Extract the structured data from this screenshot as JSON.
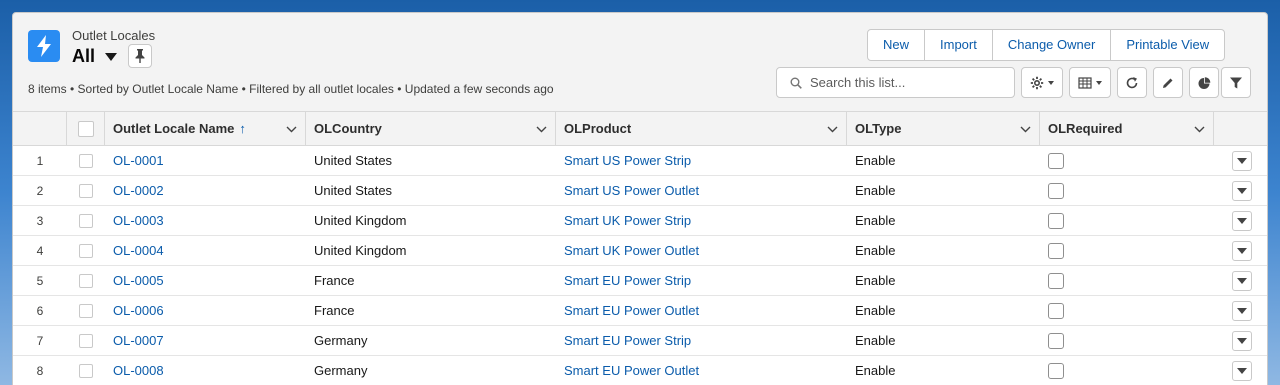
{
  "header": {
    "object_label": "Outlet Locales",
    "list_view_name": "All",
    "meta": "8 items • Sorted by Outlet Locale Name • Filtered by all outlet locales • Updated a few seconds ago",
    "icon": "lightning-bolt-icon",
    "icon_color": "#2a8cf2"
  },
  "actions": {
    "new": "New",
    "import": "Import",
    "change_owner": "Change Owner",
    "printable_view": "Printable View"
  },
  "search": {
    "placeholder": "Search this list..."
  },
  "table": {
    "columns": {
      "name": "Outlet Locale Name",
      "sort_indicator": "↑",
      "country": "OLCountry",
      "product": "OLProduct",
      "type": "OLType",
      "required": "OLRequired"
    },
    "rows": [
      {
        "num": "1",
        "name": "OL-0001",
        "country": "United States",
        "product": "Smart US Power Strip",
        "type": "Enable",
        "required": false
      },
      {
        "num": "2",
        "name": "OL-0002",
        "country": "United States",
        "product": "Smart US Power Outlet",
        "type": "Enable",
        "required": false
      },
      {
        "num": "3",
        "name": "OL-0003",
        "country": "United Kingdom",
        "product": "Smart UK Power Strip",
        "type": "Enable",
        "required": false
      },
      {
        "num": "4",
        "name": "OL-0004",
        "country": "United Kingdom",
        "product": "Smart UK Power Outlet",
        "type": "Enable",
        "required": false
      },
      {
        "num": "5",
        "name": "OL-0005",
        "country": "France",
        "product": "Smart EU Power Strip",
        "type": "Enable",
        "required": false
      },
      {
        "num": "6",
        "name": "OL-0006",
        "country": "France",
        "product": "Smart EU Power Outlet",
        "type": "Enable",
        "required": false
      },
      {
        "num": "7",
        "name": "OL-0007",
        "country": "Germany",
        "product": "Smart EU Power Strip",
        "type": "Enable",
        "required": false
      },
      {
        "num": "8",
        "name": "OL-0008",
        "country": "Germany",
        "product": "Smart EU Power Outlet",
        "type": "Enable",
        "required": false
      }
    ]
  },
  "colors": {
    "link": "#0b5cab",
    "brand": "#2a8cf2"
  }
}
